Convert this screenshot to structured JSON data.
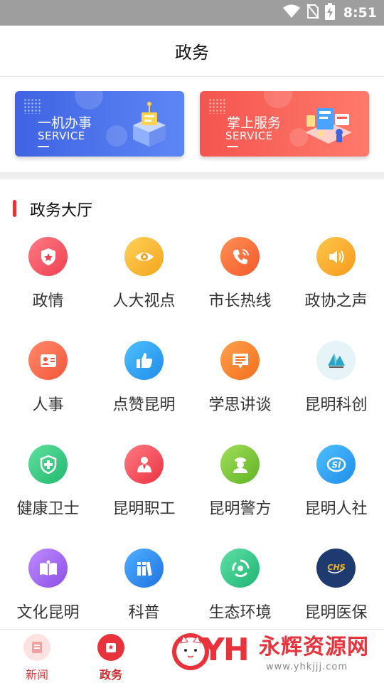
{
  "status": {
    "time": "8:51"
  },
  "header": {
    "title": "政务"
  },
  "banners": [
    {
      "title": "一机办事",
      "subtitle": "SERVICE",
      "color": "#4a6ef0"
    },
    {
      "title": "掌上服务",
      "subtitle": "SERVICE",
      "color": "#f85d55"
    }
  ],
  "section": {
    "title": "政务大厅",
    "accent": "#e8323c"
  },
  "grid": [
    {
      "label": "政情",
      "icon": "police-badge-icon",
      "color": "#f25461"
    },
    {
      "label": "人大视点",
      "icon": "eye-icon",
      "color": "#f7b52d"
    },
    {
      "label": "市长热线",
      "icon": "phone-icon",
      "color": "#fb6d3e"
    },
    {
      "label": "政协之声",
      "icon": "speaker-icon",
      "color": "#fbab2d"
    },
    {
      "label": "人事",
      "icon": "person-card-icon",
      "color": "#fb6d4f"
    },
    {
      "label": "点赞昆明",
      "icon": "thumbs-up-icon",
      "color": "#2fa3f3"
    },
    {
      "label": "学思讲谈",
      "icon": "chat-bubble-icon",
      "color": "#fb7a2e"
    },
    {
      "label": "昆明科创",
      "icon": "kunming-science-logo-icon",
      "color": "#4fb6c9"
    },
    {
      "label": "健康卫士",
      "icon": "shield-cross-icon",
      "color": "#33c980"
    },
    {
      "label": "昆明职工",
      "icon": "worker-icon",
      "color": "#f34c56"
    },
    {
      "label": "昆明警方",
      "icon": "police-officer-icon",
      "color": "#80c93b"
    },
    {
      "label": "昆明人社",
      "icon": "social-insurance-icon",
      "color": "#2fa3f3"
    },
    {
      "label": "文化昆明",
      "icon": "book-icon",
      "color": "#a46df0"
    },
    {
      "label": "科普",
      "icon": "books-icon",
      "color": "#2f8cf0"
    },
    {
      "label": "生态环境",
      "icon": "eco-cycle-icon",
      "color": "#2ec47e"
    },
    {
      "label": "昆明医保",
      "icon": "chs-medical-insurance-icon",
      "color": "#1e3a6e"
    }
  ],
  "tabs": [
    {
      "label": "新闻",
      "icon": "news-icon"
    },
    {
      "label": "政务",
      "icon": "government-icon"
    }
  ],
  "watermark": {
    "logo": "YH",
    "text": "永辉资源网",
    "url": "www.yhkjjj.com"
  }
}
